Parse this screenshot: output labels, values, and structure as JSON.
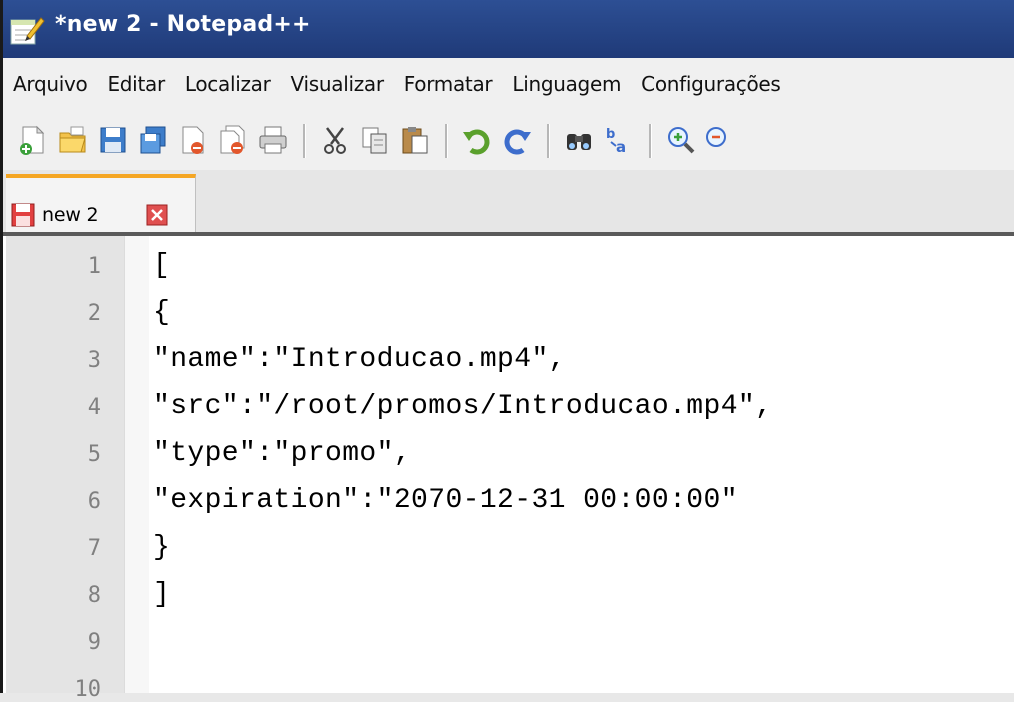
{
  "window": {
    "title": "*new 2 - Notepad++",
    "icon": "notepad-plus-plus-icon"
  },
  "menu": [
    "Arquivo",
    "Editar",
    "Localizar",
    "Visualizar",
    "Formatar",
    "Linguagem",
    "Configurações"
  ],
  "toolbar": {
    "icons": [
      "new-file-icon",
      "open-file-icon",
      "save-icon",
      "save-all-icon",
      "close-icon",
      "close-all-icon",
      "print-icon",
      "cut-icon",
      "copy-icon",
      "paste-icon",
      "undo-icon",
      "redo-icon",
      "find-icon",
      "replace-icon",
      "zoom-in-icon",
      "zoom-out-icon"
    ]
  },
  "tabs": [
    {
      "label": "new 2",
      "modified": true,
      "active": true
    }
  ],
  "editor": {
    "line_numbers": [
      "1",
      "2",
      "3",
      "4",
      "5",
      "6",
      "7",
      "8",
      "9",
      "10"
    ],
    "lines": [
      "[",
      "{",
      "\"name\":\"Introducao.mp4\",",
      "\"src\":\"/root/promos/Introducao.mp4\",",
      "\"type\":\"promo\",",
      "\"expiration\":\"2070-12-31 00:00:00\"",
      "}",
      "]",
      "",
      ""
    ]
  },
  "colors": {
    "titlebar": "#1f3a78",
    "tab_accent": "#f5a623",
    "gutter": "#e4e4e4",
    "line_number": "#808080"
  }
}
